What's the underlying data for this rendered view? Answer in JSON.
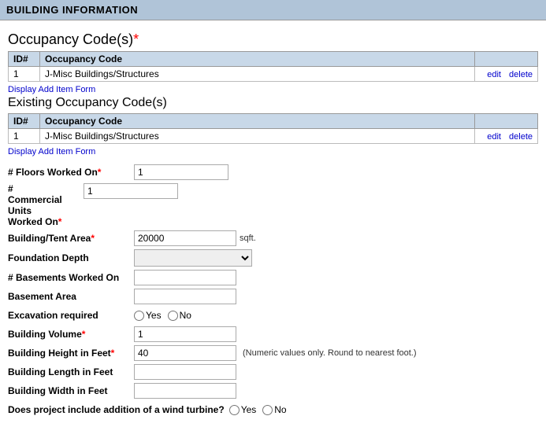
{
  "header": {
    "title": "BUILDING INFORMATION"
  },
  "occupancy_section": {
    "title": "Occupancy Code(s)",
    "required": true,
    "table": {
      "columns": [
        "ID#",
        "Occupancy Code"
      ],
      "rows": [
        {
          "id": "1",
          "code": "J-Misc Buildings/Structures",
          "edit": "edit",
          "delete": "delete"
        }
      ]
    },
    "add_link": "Display Add Item Form"
  },
  "existing_occupancy_section": {
    "title": "Existing Occupancy Code(s)",
    "required": false,
    "table": {
      "columns": [
        "ID#",
        "Occupancy Code"
      ],
      "rows": [
        {
          "id": "1",
          "code": "J-Misc Buildings/Structures",
          "edit": "edit",
          "delete": "delete"
        }
      ]
    },
    "add_link": "Display Add Item Form"
  },
  "form": {
    "floors_worked_on_label": "# Floors Worked On",
    "floors_worked_on_value": "1",
    "commercial_units_label": "#\nCommercial\nUnits\nWorked On",
    "commercial_units_line1": "#",
    "commercial_units_line2": "Commercial",
    "commercial_units_line3": "Units",
    "commercial_units_line4": "Worked On",
    "commercial_units_value": "1",
    "building_tent_area_label": "Building/Tent Area",
    "building_tent_area_value": "20000",
    "building_tent_area_unit": "sqft.",
    "foundation_depth_label": "Foundation Depth",
    "foundation_depth_options": [
      ""
    ],
    "basements_worked_on_label": "# Basements Worked On",
    "basements_worked_on_value": "",
    "basement_area_label": "Basement Area",
    "basement_area_value": "",
    "excavation_required_label": "Excavation required",
    "excavation_yes": "Yes",
    "excavation_no": "No",
    "building_volume_label": "Building Volume",
    "building_volume_value": "1",
    "building_height_label": "Building Height in Feet",
    "building_height_value": "40",
    "building_height_hint": "(Numeric values only. Round to nearest foot.)",
    "building_length_label": "Building Length in Feet",
    "building_length_value": "",
    "building_width_label": "Building Width in Feet",
    "building_width_value": "",
    "wind_turbine_label": "Does project include addition of a wind turbine?",
    "wind_turbine_yes": "Yes",
    "wind_turbine_no": "No"
  }
}
